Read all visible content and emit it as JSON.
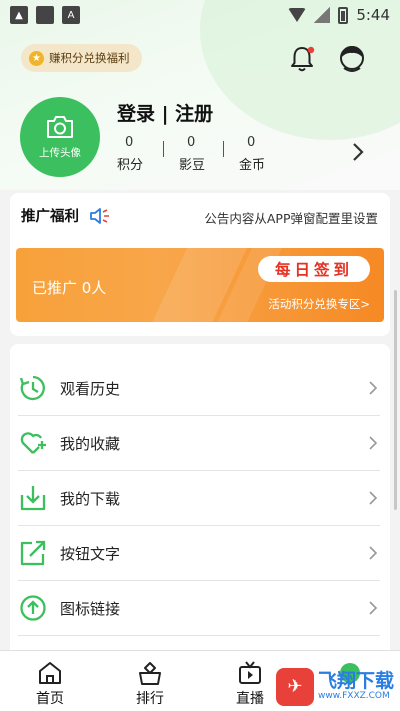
{
  "status_bar": {
    "time": "5:44"
  },
  "header": {
    "points_pill_label": "赚积分兑换福利"
  },
  "profile": {
    "avatar_label": "上传头像",
    "login_label": "登录 | 注册",
    "stats": [
      {
        "value": "0",
        "label": "积分"
      },
      {
        "value": "0",
        "label": "影豆"
      },
      {
        "value": "0",
        "label": "金币"
      }
    ]
  },
  "promo": {
    "title": "推广福利",
    "announcement": "公告内容从APP弹窗配置里设置",
    "promoted_count_text": "已推广 0人",
    "signin_label": "每日签到",
    "exchange_link": "活动积分兑换专区>"
  },
  "menu": {
    "items": [
      {
        "label": "观看历史",
        "icon": "history-icon"
      },
      {
        "label": "我的收藏",
        "icon": "favorite-icon"
      },
      {
        "label": "我的下载",
        "icon": "download-icon"
      },
      {
        "label": "按钮文字",
        "icon": "share-icon"
      },
      {
        "label": "图标链接",
        "icon": "upload-arrow-icon"
      }
    ]
  },
  "tabbar": {
    "tabs": [
      {
        "label": "首页",
        "icon": "home-icon"
      },
      {
        "label": "排行",
        "icon": "ranking-icon"
      },
      {
        "label": "直播",
        "icon": "live-tv-icon"
      }
    ]
  },
  "watermark": {
    "text": "飞翔下载",
    "sub": "www.FXXZ.COM"
  },
  "colors": {
    "accent_green": "#3cbf5e",
    "banner_orange": "#f7a13a",
    "signin_red": "#e53322"
  }
}
